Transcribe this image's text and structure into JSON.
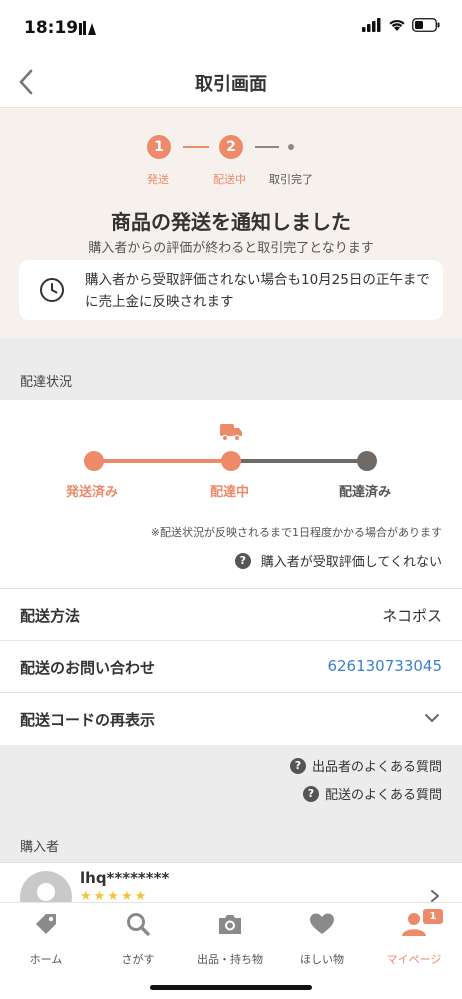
{
  "status_bar": {
    "time": "18:19"
  },
  "header": {
    "title": "取引画面"
  },
  "progress": {
    "steps": [
      {
        "number": "1",
        "label": "発送"
      },
      {
        "number": "2",
        "label": "配送中"
      },
      {
        "number": "",
        "label": "取引完了"
      }
    ],
    "current_step": 2,
    "notice_title": "商品の発送を通知しました",
    "notice_subtitle": "購入者からの評価が終わると取引完了となります",
    "info_text": "購入者から受取評価されない場合も10月25日の正午までに売上金に反映されます"
  },
  "delivery": {
    "section_title": "配達状況",
    "stages": [
      "発送済み",
      "配達中",
      "配達済み"
    ],
    "current_stage": 2,
    "note": "※配送状況が反映されるまで1日程度かかる場合があります",
    "help_link": "購入者が受取評価してくれない",
    "method_label": "配送方法",
    "method_value": "ネコポス",
    "inquiry_label": "配送のお問い合わせ",
    "inquiry_value": "626130733045",
    "code_label": "配送コードの再表示"
  },
  "faq": {
    "seller_faq": "出品者のよくある質問",
    "shipping_faq": "配送のよくある質問"
  },
  "buyer": {
    "section_title": "購入者",
    "name": "lhq********",
    "stars": "★★★★★"
  },
  "tabbar": {
    "tabs": [
      {
        "label": "ホーム",
        "icon": "tag-icon"
      },
      {
        "label": "さがす",
        "icon": "search-icon"
      },
      {
        "label": "出品・持ち物",
        "icon": "camera-icon"
      },
      {
        "label": "ほしい物",
        "icon": "heart-icon"
      },
      {
        "label": "マイページ",
        "icon": "person-icon"
      }
    ],
    "active_index": 4,
    "mypage_badge": "1"
  },
  "colors": {
    "accent": "#ed8a6a",
    "link": "#3a7fd5",
    "inactive": "#6f6a66",
    "tab_inactive": "#8a8a8a"
  }
}
